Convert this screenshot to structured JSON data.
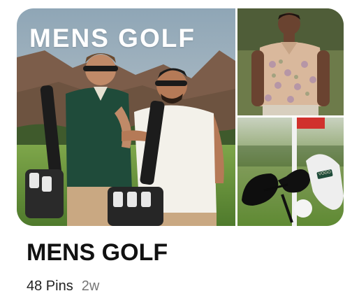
{
  "board": {
    "title": "MENS GOLF",
    "cover_overlay_text": "MENS GOLF",
    "pin_count": "48 Pins",
    "updated": "2w",
    "case_brand": "VOGO"
  },
  "colors": {
    "title": "#111111",
    "meta_secondary": "#767676",
    "sky": "#9fb2c0",
    "mountain": "#7a5a48",
    "grass": "#6c9a3e"
  }
}
